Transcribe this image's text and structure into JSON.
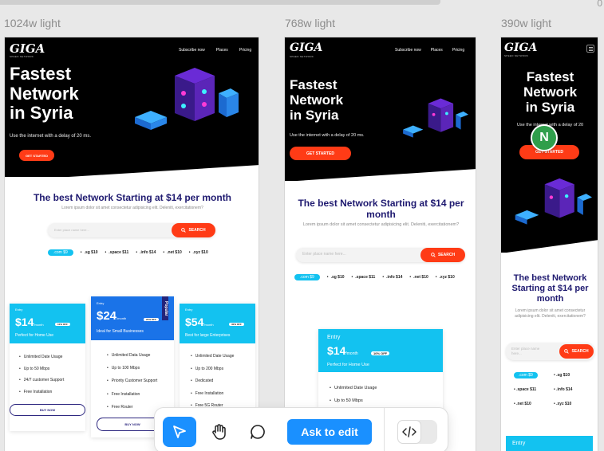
{
  "canvas": {
    "top_right_value": "0"
  },
  "frames": {
    "desktop": {
      "label": "1024w light"
    },
    "tablet": {
      "label": "768w light"
    },
    "mobile": {
      "label": "390w light"
    }
  },
  "brand": {
    "logo": "GIGA",
    "sub": "SPEED NETWORK"
  },
  "nav": [
    "Subscribe now",
    "Places",
    "Pricing"
  ],
  "hero": {
    "title_lines": [
      "Fastest",
      "Network",
      "in Syria"
    ],
    "tagline": "Use the internet with a delay of 20 ms.",
    "cta": "GET STARTED"
  },
  "section": {
    "title": "The best Network Starting at $14 per month",
    "desc": "Lorem ipsum dolor sit amet consectetur adipisicing elit. Deleniti, exercitationem?",
    "search_placeholder": "Enter place name here...",
    "search_btn": "SEARCH"
  },
  "domains": [
    ".com $9",
    ".sg $10",
    ".space $11",
    ".info $14",
    ".net $10",
    ".xyz $10"
  ],
  "plans": [
    {
      "label": "Entry",
      "price": "$14",
      "per": "/month",
      "off": "10% OFF",
      "sub": "Perfect for Home Use",
      "color": "#13c2f0",
      "features": [
        "Unlimited Date Usage",
        "Up to 50 Mbps",
        "24/7 customer Support",
        "Free Installation"
      ],
      "buy": "BUY NOW"
    },
    {
      "label": "Entry",
      "price": "$24",
      "per": "/month",
      "off": "20% OFF",
      "sub": "Ideal for Small Businesses",
      "color": "#1a73e8",
      "popular": "Popular",
      "features": [
        "Unlimited Data Usage",
        "Up to 100 Mbps",
        "Priority Customer Support",
        "Free Installation",
        "Free Router"
      ],
      "buy": "BUY NOW"
    },
    {
      "label": "Entry",
      "price": "$54",
      "per": "/month",
      "off": "30% OFF",
      "sub": "Best for large Enterprises",
      "color": "#13c2f0",
      "features": [
        "Unlimited Date Usage",
        "Up to 200 Mbps",
        "Dedicated",
        "Free Installation",
        "Free 5G Router"
      ],
      "buy": "BUY NOW"
    }
  ],
  "tablet_plan": {
    "label": "Entry",
    "price": "$14",
    "per": "/month",
    "off": "10% OFF",
    "sub": "Perfect for Home Use",
    "features": [
      "Unlimited Date Usage",
      "Up to 50 Mbps"
    ]
  },
  "mobile_plan": {
    "label": "Entry"
  },
  "avatar": {
    "initial": "N",
    "color": "#2f9e4b"
  },
  "toolbar": {
    "ask_label": "Ask to edit"
  },
  "colors": {
    "accent": "#ff3b16",
    "navy": "#1f1a70",
    "cyan": "#13c2f0",
    "tool_blue": "#1a90ff"
  }
}
